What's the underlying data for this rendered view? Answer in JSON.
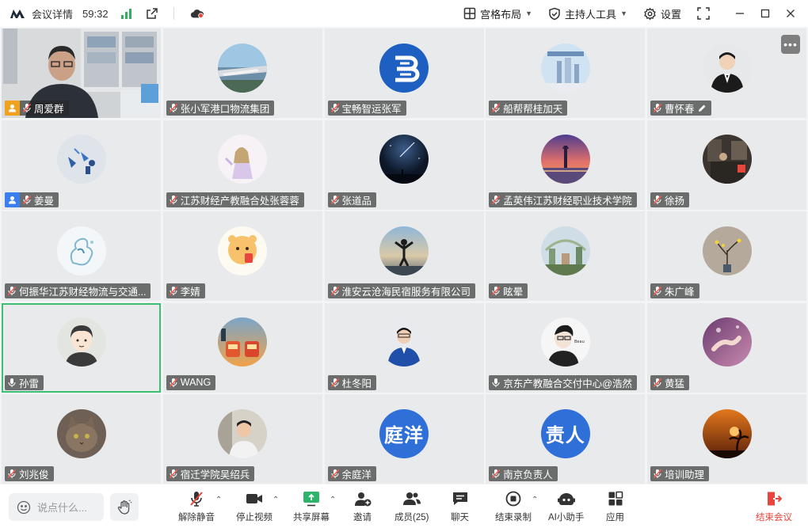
{
  "titlebar": {
    "meeting_info": "会议详情",
    "timer": "59:32",
    "layout_label": "宫格布局",
    "host_tools_label": "主持人工具",
    "settings_label": "设置"
  },
  "participants": [
    {
      "name": "周爱群",
      "role": "host",
      "mic": "muted",
      "video": true
    },
    {
      "name": "张小军港口物流集团",
      "mic": "muted",
      "avatar": "photo-train"
    },
    {
      "name": "宝畅智运张军",
      "mic": "muted",
      "avatar": "logo-blue"
    },
    {
      "name": "船帮帮桂加天",
      "mic": "muted",
      "avatar": "photo-building"
    },
    {
      "name": "曹怀春",
      "mic": "muted",
      "avatar": "photo-man",
      "editing": true
    },
    {
      "name": "姜曼",
      "role": "cohost",
      "mic": "muted",
      "avatar": "photo-art"
    },
    {
      "name": "江苏财经产教融合处张蓉蓉",
      "mic": "muted",
      "avatar": "photo-girl"
    },
    {
      "name": "张道品",
      "mic": "muted",
      "avatar": "photo-night"
    },
    {
      "name": "孟英伟江苏财经职业技术学院",
      "mic": "muted",
      "avatar": "photo-sunset"
    },
    {
      "name": "徐扬",
      "mic": "muted",
      "avatar": "photo-room"
    },
    {
      "name": "何振华江苏财经物流与交通...",
      "mic": "muted",
      "avatar": "photo-ink"
    },
    {
      "name": "李婧",
      "mic": "muted",
      "avatar": "photo-cartoon"
    },
    {
      "name": "淮安云沧海民宿服务有限公司",
      "mic": "muted",
      "avatar": "photo-beach"
    },
    {
      "name": "眩晕",
      "mic": "muted",
      "avatar": "photo-garden"
    },
    {
      "name": "朱广峰",
      "mic": "muted",
      "avatar": "photo-flower"
    },
    {
      "name": "孙雷",
      "mic": "on",
      "avatar": "cartoon-man",
      "speaking": true
    },
    {
      "name": "WANG",
      "mic": "muted",
      "avatar": "photo-trains"
    },
    {
      "name": "杜冬阳",
      "mic": "muted",
      "avatar": "photo-suit"
    },
    {
      "name": "京东产教融合交付中心@浩然",
      "mic": "on",
      "avatar": "drawing-man"
    },
    {
      "name": "黄猛",
      "mic": "muted",
      "avatar": "photo-hands"
    },
    {
      "name": "刘兆俊",
      "mic": "muted",
      "avatar": "photo-cat"
    },
    {
      "name": "宿迁学院吴绍兵",
      "mic": "muted",
      "avatar": "photo-car"
    },
    {
      "name": "余庭洋",
      "mic": "muted",
      "avatar_text": "庭洋",
      "avatar_color": "#2f6fd8"
    },
    {
      "name": "南京负责人",
      "mic": "muted",
      "avatar_text": "责人",
      "avatar_color": "#2f6fd8"
    },
    {
      "name": "培训助理",
      "mic": "muted",
      "avatar": "photo-palm"
    }
  ],
  "toolbar": {
    "chat_placeholder": "说点什么...",
    "unmute": "解除静音",
    "stop_video": "停止视频",
    "share_screen": "共享屏幕",
    "invite": "邀请",
    "members": "成员(25)",
    "chat": "聊天",
    "end_recording": "结束录制",
    "ai_assistant": "AI小助手",
    "apps": "应用",
    "end_meeting": "结束会议"
  },
  "colors": {
    "accent": "#3a7ef0",
    "speaking": "#3dbf73",
    "danger": "#e8453c",
    "signal": "#31b15d"
  }
}
